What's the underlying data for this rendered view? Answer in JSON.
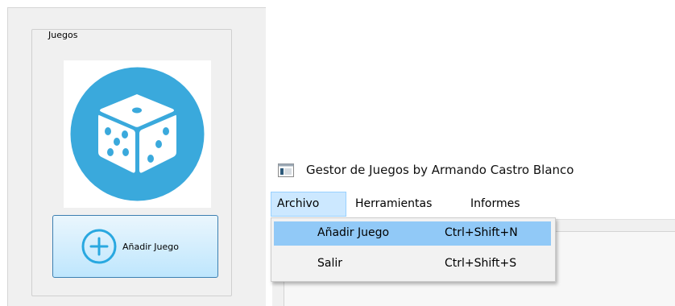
{
  "left_panel": {
    "group_title": "Juegos",
    "add_game_button_label": "Añadir Juego"
  },
  "window": {
    "title": "Gestor de Juegos by Armando Castro Blanco"
  },
  "menubar": {
    "items": [
      {
        "label": "Archivo",
        "active": true
      },
      {
        "label": "Herramientas"
      },
      {
        "label": "Informes"
      }
    ]
  },
  "archivo_menu": {
    "items": [
      {
        "label": "Añadir Juego",
        "shortcut": "Ctrl+Shift+N",
        "highlighted": true
      },
      {
        "label": "Salir",
        "shortcut": "Ctrl+Shift+S"
      }
    ]
  },
  "icons": {
    "dice": "dice-icon",
    "add": "plus-circle-icon",
    "app": "app-window-icon"
  },
  "colors": {
    "dice_circle": "#3aa9dc",
    "highlight": "#91c9f7",
    "menu_active": "#cce8ff",
    "button_border": "#3c7fb1"
  }
}
